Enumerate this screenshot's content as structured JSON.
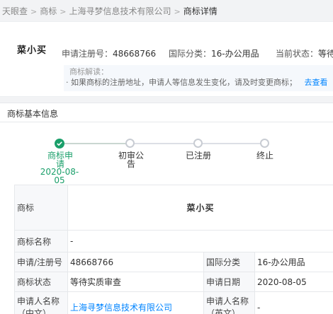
{
  "breadcrumb": {
    "items": [
      "天眼查",
      "商标",
      "上海寻梦信息技术有限公司",
      "商标详情"
    ],
    "separator": ">"
  },
  "header": {
    "trademark_name": "菜小买",
    "reg_no_label": "申请注册号：",
    "reg_no": "48668766",
    "class_label": "国际分类：",
    "class_value": "16-办公用品",
    "status_label": "当前状态：",
    "status_value": "等待实质审查"
  },
  "notice": {
    "title": "商标解读：",
    "body": "· 如果商标的注册地址，申请人等信息发生变化，请及时变更商标；",
    "link": "去查看"
  },
  "section": {
    "title": "商标基本信息"
  },
  "progress": {
    "steps": [
      {
        "label": "商标申请",
        "date": "2020-08-05",
        "state": "done"
      },
      {
        "label": "初审公告",
        "date": "",
        "state": "pending"
      },
      {
        "label": "已注册",
        "date": "",
        "state": "pending"
      },
      {
        "label": "终止",
        "date": "",
        "state": "pending"
      }
    ]
  },
  "table": {
    "trademark_label": "商标",
    "trademark_value": "菜小买",
    "name_label": "商标名称",
    "name_value": "-",
    "reg_label": "申请/注册号",
    "reg_value": "48668766",
    "class_label": "国际分类",
    "class_value": "16-办公用品",
    "status_label": "商标状态",
    "status_value": "等待实质审查",
    "date_label": "申请日期",
    "date_value": "2020-08-05",
    "applicant_cn_label_1": "申请人名称",
    "applicant_cn_label_2": "（中文）",
    "applicant_cn_value": "上海寻梦信息技术有限公司",
    "applicant_en_label_1": "申请人名称",
    "applicant_en_label_2": "（英文）",
    "applicant_en_value": "-"
  },
  "colors": {
    "accent_green": "#1a9f6a",
    "link_blue": "#0084ff"
  },
  "icons": {
    "done_step": "check-icon",
    "pending_step": "empty-circle-icon"
  }
}
